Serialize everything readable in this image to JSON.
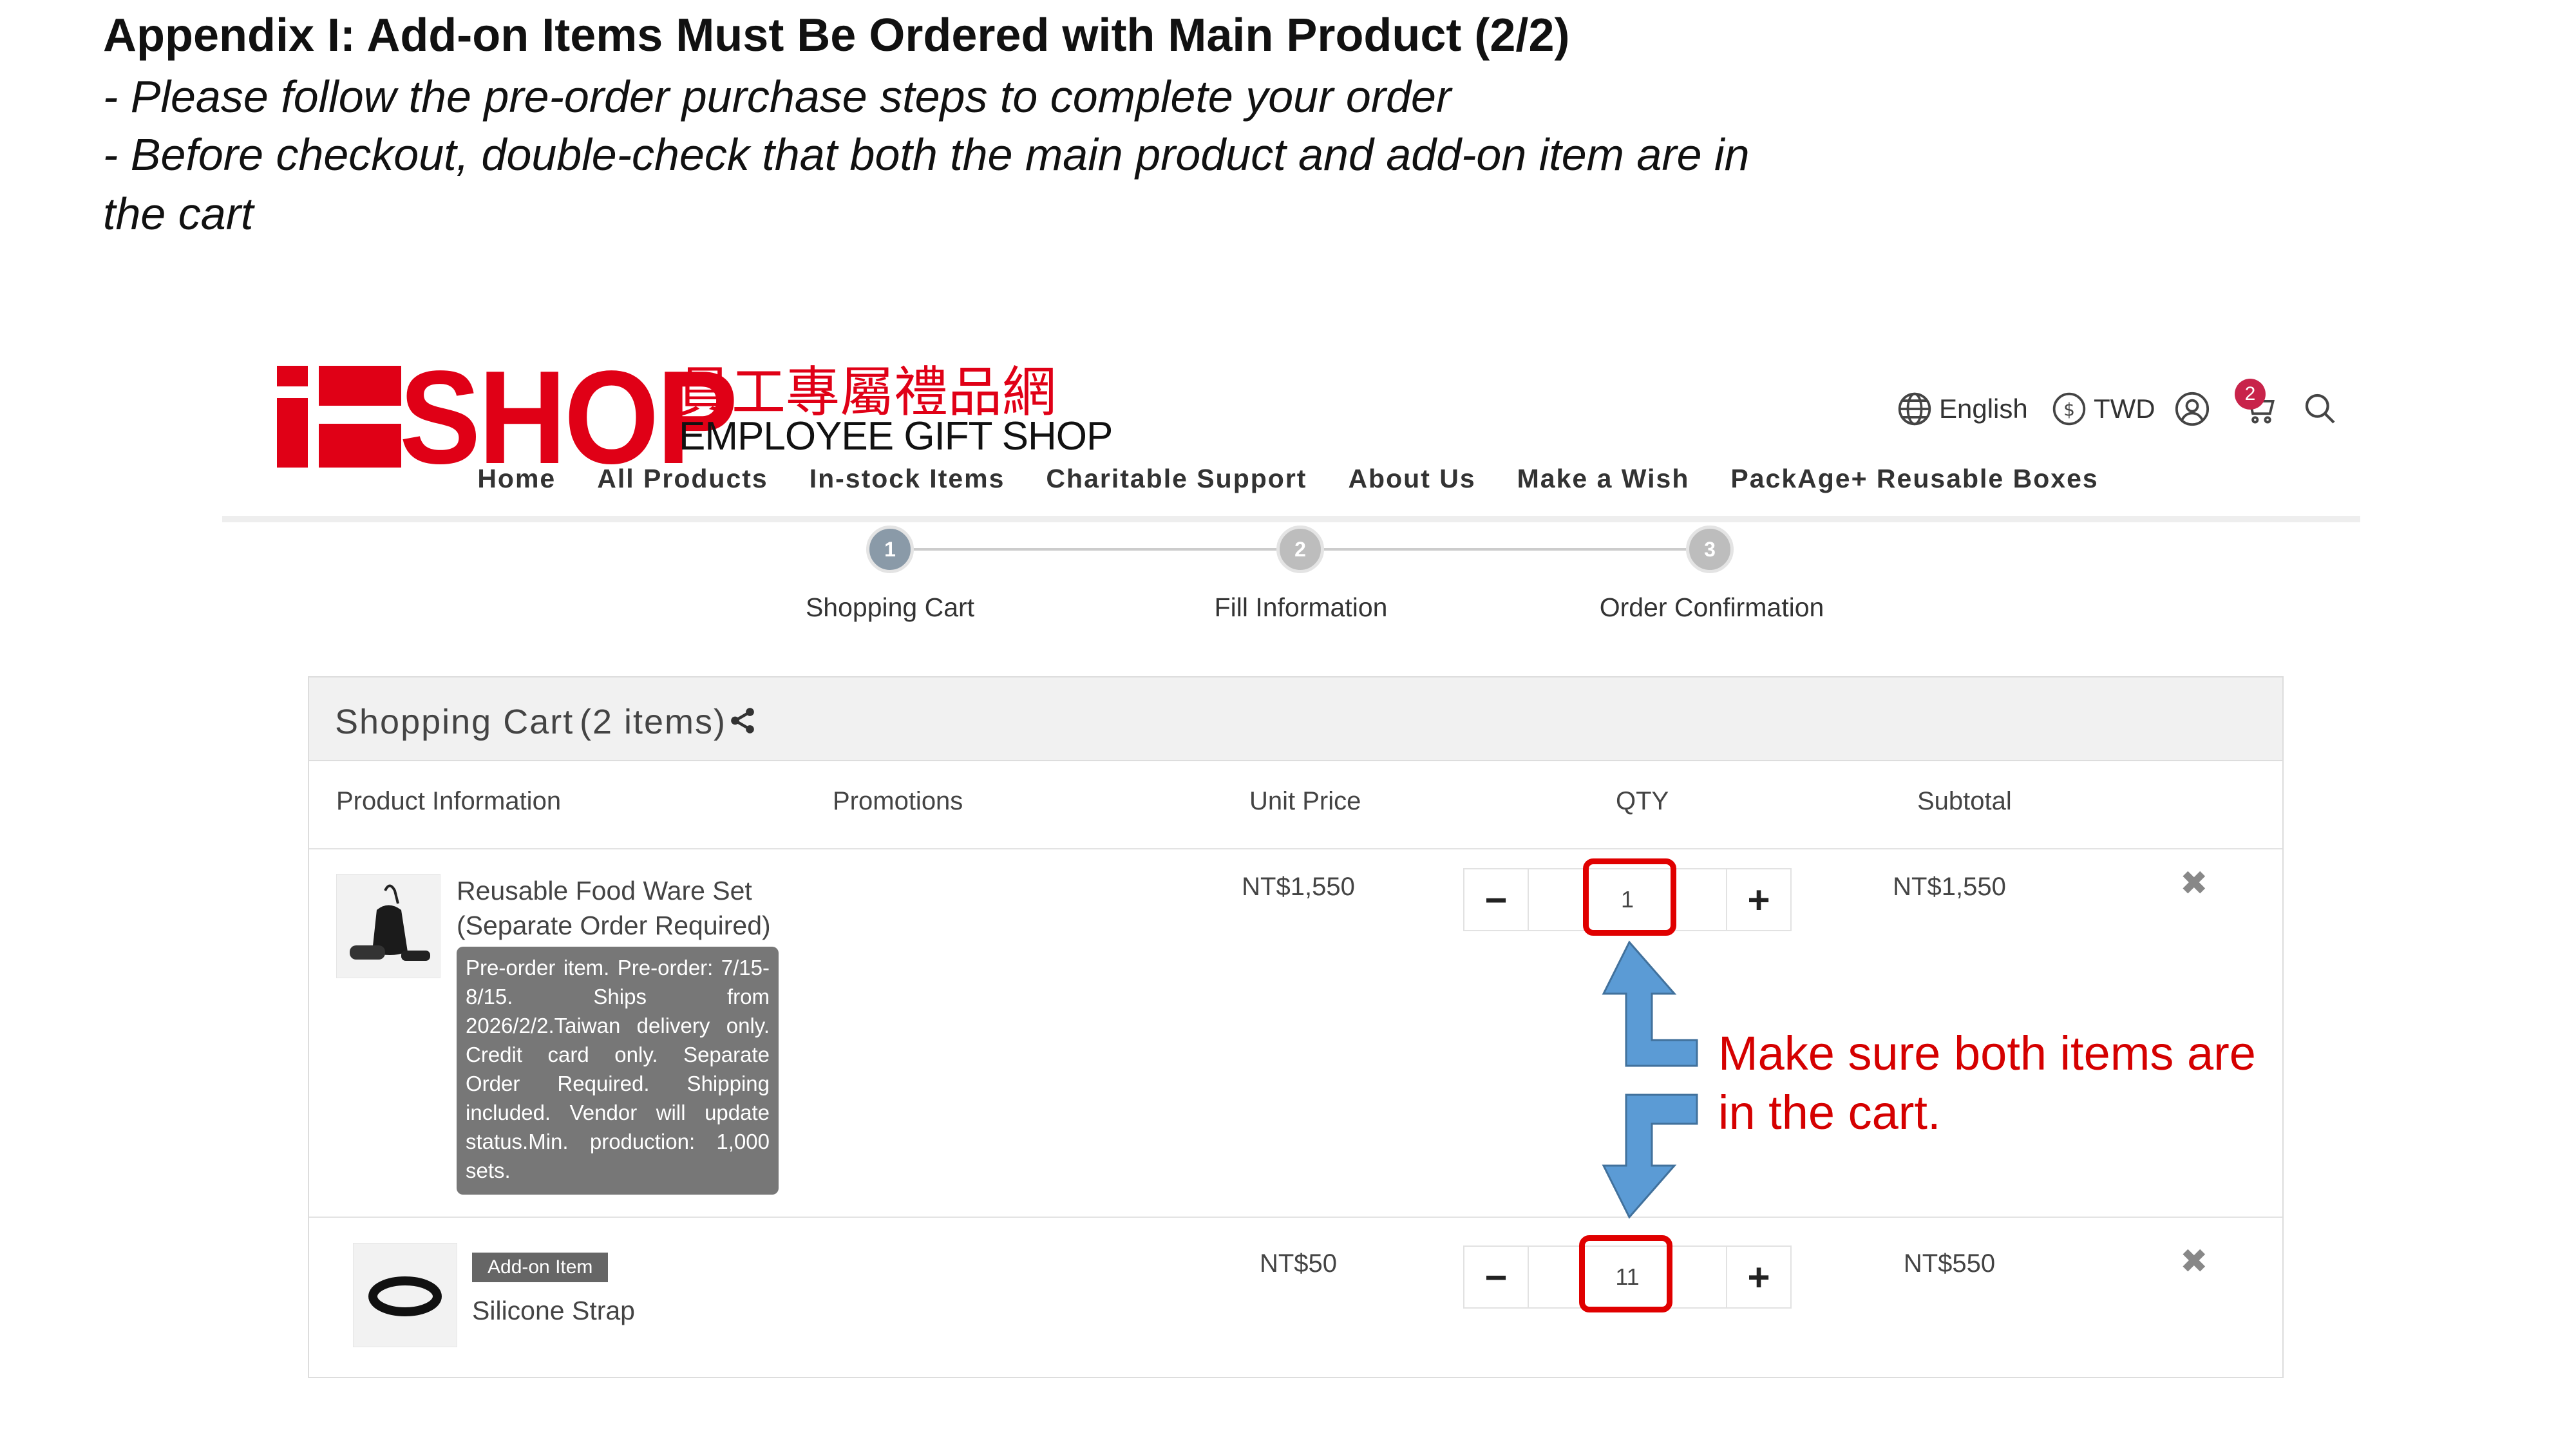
{
  "slide": {
    "title": "Appendix I: Add-on Items Must Be Ordered with Main Product (2/2)",
    "notes": [
      "- Please follow the pre-order purchase steps to complete your order",
      "- Before checkout, double-check that both the main product and add-on item are in",
      "the cart"
    ]
  },
  "header": {
    "logo": {
      "shop": "SHOP",
      "cjk": "員工專屬禮品網",
      "subtitle": "EMPLOYEE GIFT SHOP"
    },
    "language": "English",
    "currency": "TWD",
    "cart_badge": "2",
    "icons": [
      "globe-icon",
      "dollar-icon",
      "user-icon",
      "cart-icon",
      "search-icon"
    ]
  },
  "nav": [
    "Home",
    "All Products",
    "In-stock Items",
    "Charitable Support",
    "About Us",
    "Make a Wish",
    "PackAge+ Reusable Boxes"
  ],
  "steps": [
    {
      "num": "1",
      "label": "Shopping Cart",
      "active": true
    },
    {
      "num": "2",
      "label": "Fill Information",
      "active": false
    },
    {
      "num": "3",
      "label": "Order Confirmation",
      "active": false
    }
  ],
  "cart": {
    "title": "Shopping Cart",
    "count": "(2 items)",
    "columns": [
      "Product Information",
      "Promotions",
      "Unit Price",
      "QTY",
      "Subtotal"
    ],
    "items": [
      {
        "name_line1": "Reusable Food Ware Set",
        "name_line2": "(Separate Order Required)",
        "note": "Pre-order item. Pre-order: 7/15-8/15. Ships from 2026/2/2.Taiwan delivery only. Credit card only. Separate Order Required. Shipping included. Vendor will update status.Min. production: 1,000 sets.",
        "unit_price": "NT$1,550",
        "qty": "1",
        "subtotal": "NT$1,550"
      },
      {
        "badge": "Add-on Item",
        "name_line1": "Silicone Strap",
        "unit_price": "NT$50",
        "qty": "11",
        "subtotal": "NT$550"
      }
    ],
    "qty_minus": "−",
    "qty_plus": "+",
    "remove": "✖"
  },
  "annotation": {
    "line1": "Make sure both items are",
    "line2": "in the cart.",
    "highlight_color": "#e00000",
    "arrow_color": "#5b9bd5"
  },
  "colors": {
    "brand_red": "#e00016",
    "step_active": "#8a9aa8",
    "step_inactive": "#bdbdbd"
  }
}
